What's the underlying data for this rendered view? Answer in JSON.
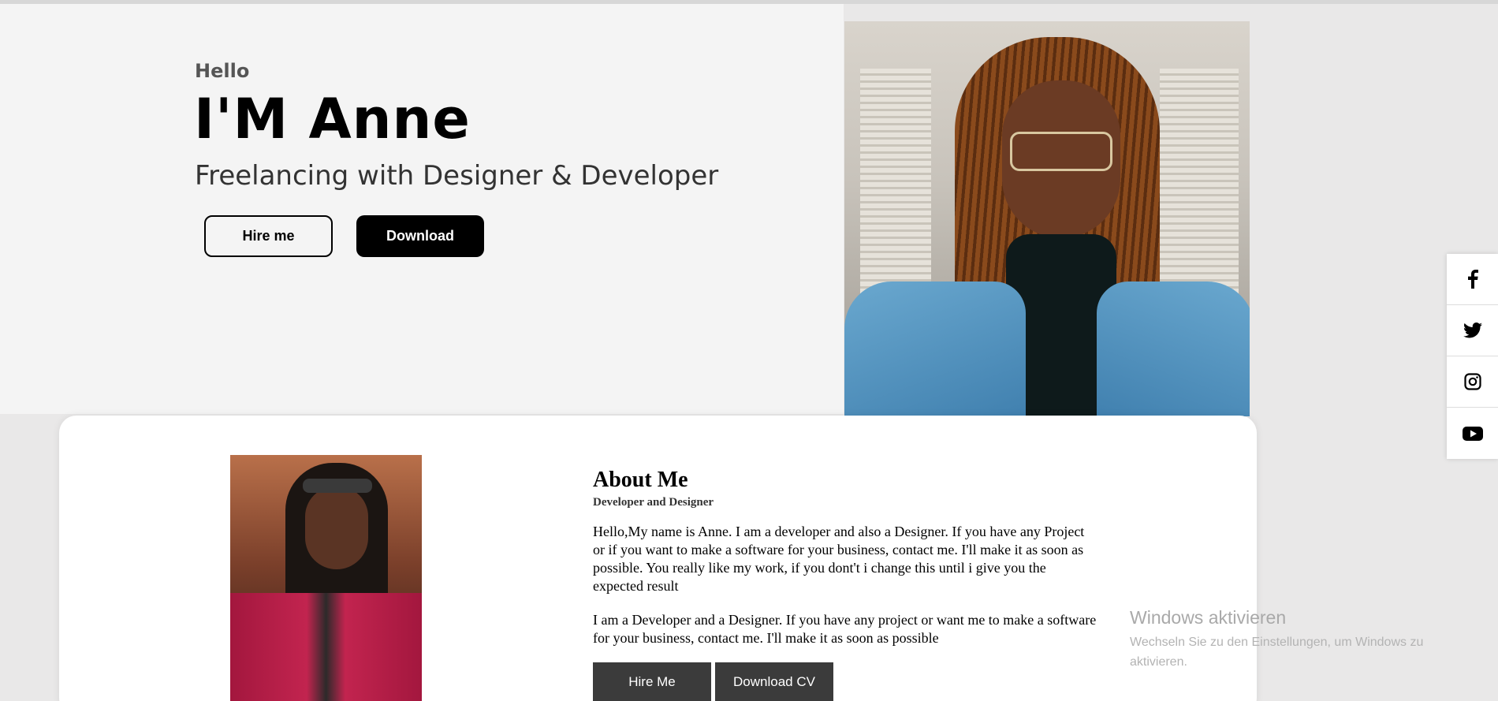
{
  "hero": {
    "greeting": "Hello",
    "name": "I'M Anne",
    "tagline": "Freelancing with Designer & Developer",
    "hire_label": "Hire me",
    "download_label": "Download"
  },
  "social": {
    "items": [
      {
        "icon": "facebook-icon"
      },
      {
        "icon": "twitter-icon"
      },
      {
        "icon": "instagram-icon"
      },
      {
        "icon": "youtube-icon"
      }
    ]
  },
  "about": {
    "title": "About Me",
    "subtitle": "Developer and Designer",
    "paragraph1": "Hello,My name is Anne. I am a developer and also a Designer. If you have any Project or if you want to make a software for your business, contact me. I'll make it as soon as possible. You really like my work, if you dont't i change this until i give you the expected result",
    "paragraph2": "I am a Developer and a Designer. If you have any project or want me to make a software for your business, contact me. I'll make it as soon as possible",
    "hire_label": "Hire Me",
    "cv_label": "Download CV"
  },
  "watermark": {
    "title": "Windows aktivieren",
    "subtitle": "Wechseln Sie zu den Einstellungen, um Windows zu aktivieren."
  },
  "colors": {
    "hero_background": "#f4f4f4",
    "page_background": "#e9e8e8",
    "primary_button": "#000000",
    "dark_button": "#3b3b3b"
  }
}
